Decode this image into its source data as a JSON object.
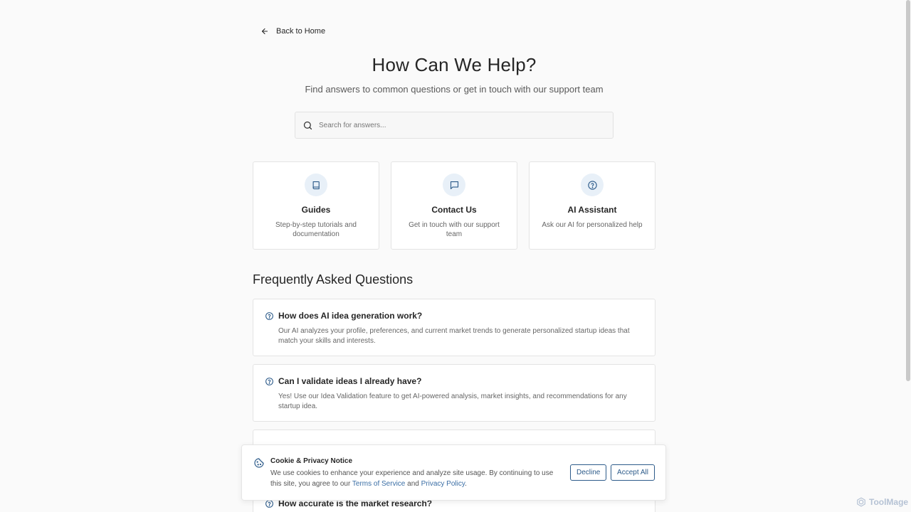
{
  "nav": {
    "back_label": "Back to Home"
  },
  "hero": {
    "title": "How Can We Help?",
    "subtitle": "Find answers to common questions or get in touch with our support team"
  },
  "search": {
    "placeholder": "Search for answers..."
  },
  "cards": [
    {
      "icon": "book-icon",
      "title": "Guides",
      "description": "Step-by-step tutorials and documentation"
    },
    {
      "icon": "chat-icon",
      "title": "Contact Us",
      "description": "Get in touch with our support team"
    },
    {
      "icon": "help-circle-icon",
      "title": "AI Assistant",
      "description": "Ask our AI for personalized help"
    }
  ],
  "faq": {
    "heading": "Frequently Asked Questions",
    "items": [
      {
        "question": "How does AI idea generation work?",
        "answer": "Our AI analyzes your profile, preferences, and current market trends to generate personalized startup ideas that match your skills and interests."
      },
      {
        "question": "Can I validate ideas I already have?",
        "answer": "Yes! Use our Idea Validation feature to get AI-powered analysis, market insights, and recommendations for any startup idea."
      },
      {
        "question": "How accurate is the market research?",
        "answer": ""
      }
    ]
  },
  "cookie": {
    "title": "Cookie & Privacy Notice",
    "text_before": "We use cookies to enhance your experience and analyze site usage. By continuing to use this site, you agree to our ",
    "terms_label": "Terms of Service",
    "and_label": " and ",
    "privacy_label": "Privacy Policy",
    "period": ".",
    "decline_label": "Decline",
    "accept_label": "Accept All"
  },
  "watermark": {
    "label": "ToolMage"
  },
  "colors": {
    "accent": "#2d5b8a",
    "icon_bg": "#e8f0f8",
    "link": "#3a6ea5"
  }
}
